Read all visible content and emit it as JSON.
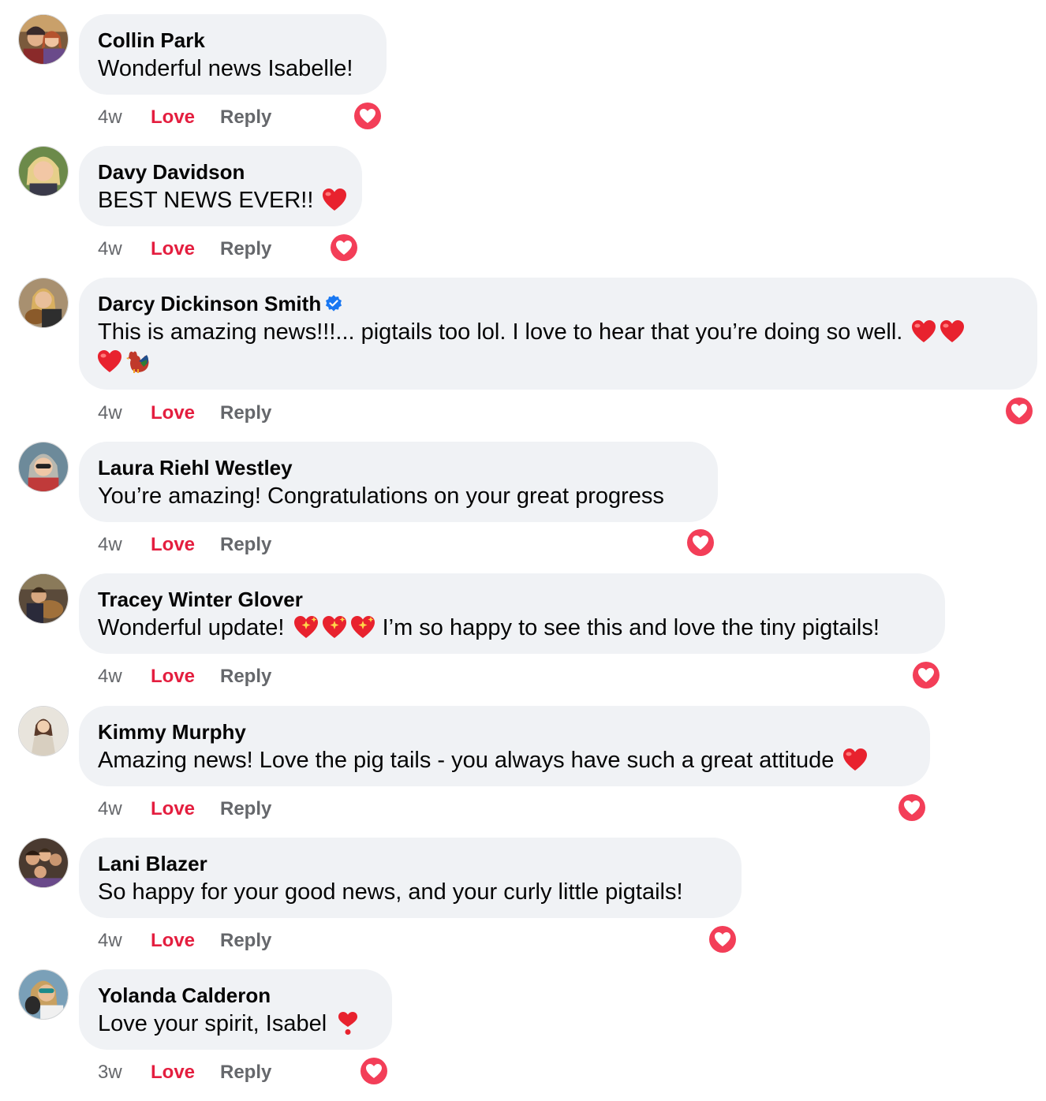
{
  "labels": {
    "love": "Love",
    "reply": "Reply"
  },
  "colors": {
    "bubble": "#f0f2f5",
    "love": "#e41e3f",
    "meta": "#65676b",
    "verified": "#1877f2"
  },
  "comments": [
    {
      "name": "Collin Park",
      "text": "Wonderful news Isabelle!",
      "time": "4w",
      "reaction": "love",
      "avatar": "couple-photo"
    },
    {
      "name": "Davy Davidson",
      "text": "BEST NEWS EVER!!",
      "emojis": [
        "red-heart"
      ],
      "time": "4w",
      "reaction": "love",
      "avatar": "woman-portrait"
    },
    {
      "name": "Darcy Dickinson Smith",
      "verified": true,
      "text": "This is amazing news!!!... pigtails too lol. I love to hear that you’re doing so well.",
      "emojis": [
        "red-heart",
        "red-heart",
        "red-heart",
        "rooster"
      ],
      "time": "4w",
      "reaction": "love",
      "avatar": "woman-with-dog"
    },
    {
      "name": "Laura Riehl Westley",
      "text": "You’re amazing! Congratulations on your great progress",
      "time": "4w",
      "reaction": "love",
      "avatar": "woman-sunglasses"
    },
    {
      "name": "Tracey Winter Glover",
      "text_before": "Wonderful update!",
      "text": "I’m so happy to see this and love the tiny pigtails!",
      "emojis": [
        "sparkling-heart",
        "sparkling-heart",
        "sparkling-heart"
      ],
      "time": "4w",
      "reaction": "love",
      "avatar": "person-with-animal"
    },
    {
      "name": "Kimmy Murphy",
      "text": "Amazing news! Love the pig tails - you always have such a great attitude",
      "emojis": [
        "red-heart"
      ],
      "time": "4w",
      "reaction": "love",
      "avatar": "woman-outdoors"
    },
    {
      "name": "Lani Blazer",
      "text": "So happy for your good news, and your curly little pigtails!",
      "time": "4w",
      "reaction": "love",
      "avatar": "group-photo"
    },
    {
      "name": "Yolanda Calderon",
      "text": "Love your spirit, Isabel",
      "emojis": [
        "heart-exclamation"
      ],
      "time": "3w",
      "reaction": "love",
      "avatar": "woman-with-pet"
    }
  ]
}
